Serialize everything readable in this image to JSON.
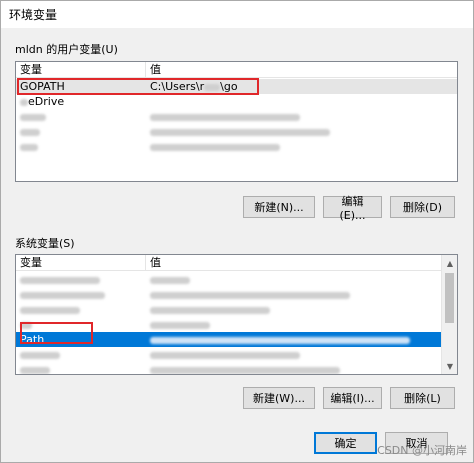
{
  "window": {
    "title": "环境变量"
  },
  "user_vars": {
    "label": "mldn 的用户变量(U)",
    "headers": {
      "var": "变量",
      "val": "值"
    },
    "rows": [
      {
        "var": "GOPATH",
        "val": "C:\\Users\\r",
        "val_tail": "\\go"
      },
      {
        "var": "eDrive",
        "val": ""
      },
      {
        "var": "",
        "val": ""
      },
      {
        "var": "",
        "val": ""
      },
      {
        "var": "",
        "val": ""
      }
    ],
    "buttons": {
      "new": "新建(N)...",
      "edit": "编辑(E)...",
      "delete": "删除(D)"
    }
  },
  "system_vars": {
    "label": "系统变量(S)",
    "headers": {
      "var": "变量",
      "val": "值"
    },
    "rows": [
      {
        "var": "",
        "val": ""
      },
      {
        "var": "",
        "val": ""
      },
      {
        "var": "",
        "val": ""
      },
      {
        "var": "",
        "val": ""
      },
      {
        "var": "Path",
        "val": ""
      },
      {
        "var": "",
        "val": ""
      },
      {
        "var": "",
        "val": ""
      }
    ],
    "buttons": {
      "new": "新建(W)...",
      "edit": "编辑(I)...",
      "delete": "删除(L)"
    }
  },
  "footer": {
    "ok": "确定",
    "cancel": "取消"
  },
  "watermark": "CSDN @小河南岸",
  "colors": {
    "selection": "#0078d7",
    "highlight_box": "#e0272a"
  }
}
